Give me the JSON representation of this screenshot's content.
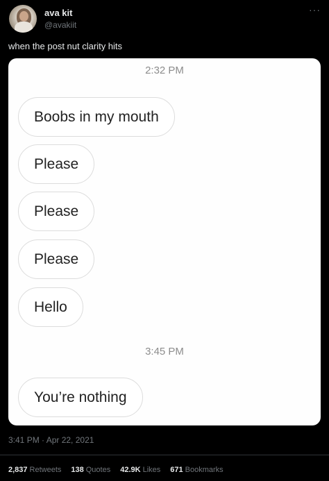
{
  "author": {
    "display_name": "ava kit",
    "handle": "@avakiit"
  },
  "more_label": "···",
  "tweet_text": "when the post nut clarity hits",
  "conversation": {
    "time_1": "2:32 PM",
    "messages_1": [
      "Boobs in my mouth",
      "Please",
      "Please",
      "Please",
      "Hello"
    ],
    "time_2": "3:45 PM",
    "messages_2": [
      "You’re nothing"
    ]
  },
  "posted_at": "3:41 PM · Apr 22, 2021",
  "stats": [
    {
      "count": "2,837",
      "label": "Retweets"
    },
    {
      "count": "138",
      "label": "Quotes"
    },
    {
      "count": "42.9K",
      "label": "Likes"
    },
    {
      "count": "671",
      "label": "Bookmarks"
    }
  ]
}
